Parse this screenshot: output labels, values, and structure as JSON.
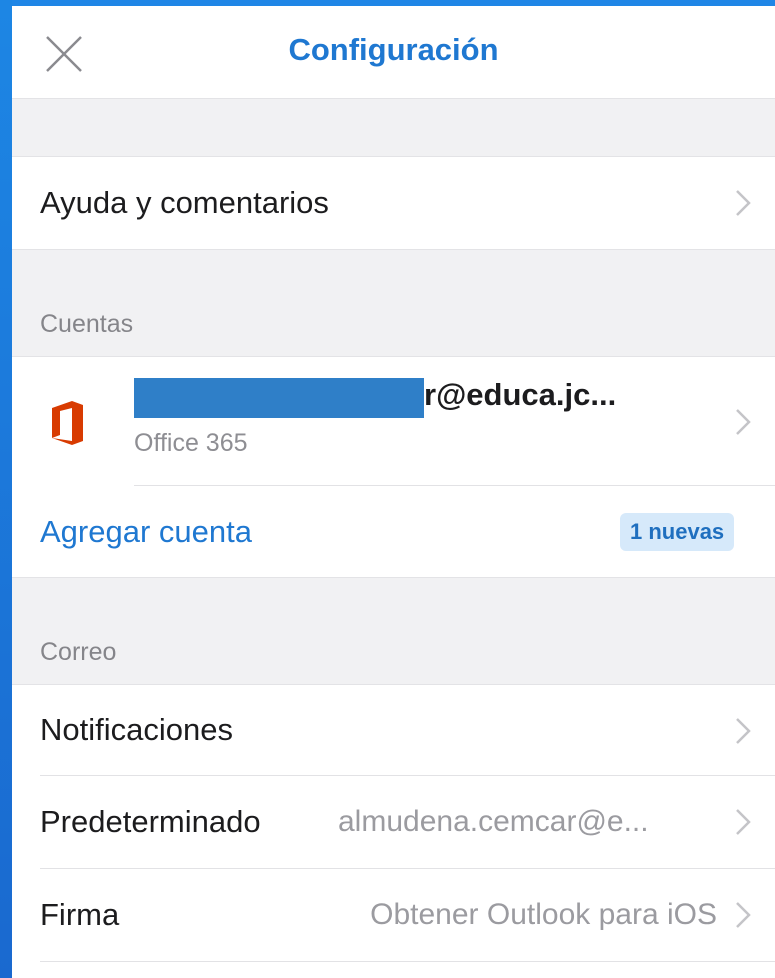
{
  "header": {
    "title": "Configuración",
    "close_icon": "close-icon"
  },
  "colors": {
    "accent": "#1f78d1",
    "office_brand": "#d83b01",
    "redaction": "#2f7fc8",
    "badge_bg": "#d6e9fa",
    "background": "#f1f1f3"
  },
  "help": {
    "label": "Ayuda y comentarios"
  },
  "accounts": {
    "section_label": "Cuentas",
    "account": {
      "email_visible": "r@educa.jc...",
      "type": "Office 365",
      "icon": "office-logo-icon"
    },
    "add_account": {
      "label": "Agregar cuenta",
      "badge": "1 nuevas"
    }
  },
  "mail": {
    "section_label": "Correo",
    "items": [
      {
        "label": "Notificaciones",
        "detail": ""
      },
      {
        "label": "Predeterminado",
        "detail": "almudena.cemcar@e..."
      },
      {
        "label": "Firma",
        "detail": "Obtener Outlook para iOS"
      }
    ]
  }
}
